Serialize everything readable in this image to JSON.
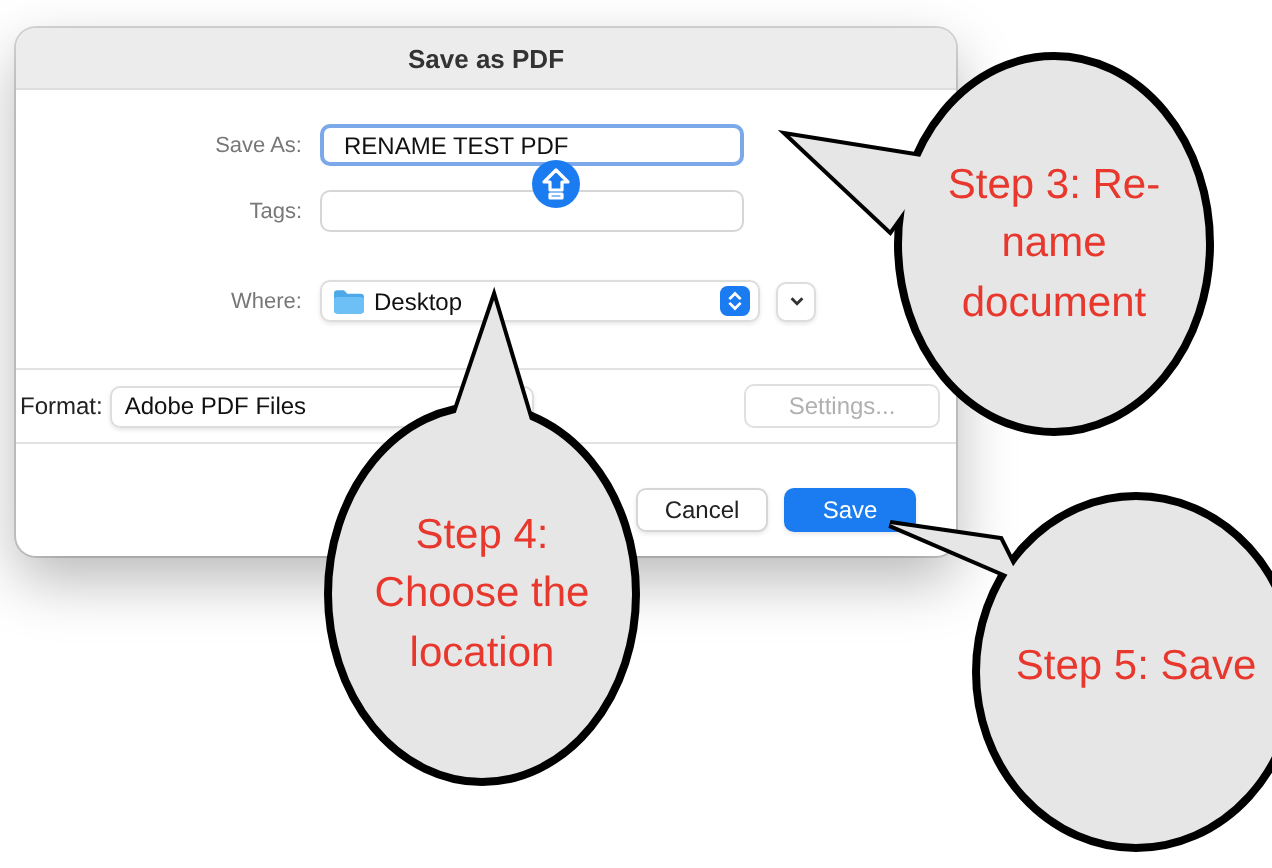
{
  "dialog": {
    "title": "Save as PDF",
    "fields": [
      {
        "label": "Save As:",
        "value": "RENAME TEST PDF",
        "focused": true
      },
      {
        "label": "Tags:",
        "focused": false
      }
    ],
    "where": {
      "label": "Where:",
      "value": "Desktop"
    },
    "format": {
      "label": "Format:",
      "value": "Adobe PDF Files"
    },
    "settings_button": {
      "label": "Settings...",
      "disabled": true
    },
    "buttons": [
      {
        "label": "Cancel",
        "default": false
      },
      {
        "label": "Save",
        "default": true
      }
    ]
  },
  "callouts": [
    {
      "lines": [
        "Step 3: Re-",
        "name",
        "document"
      ]
    },
    {
      "lines": [
        "Step 4:",
        "Choose the",
        "location"
      ]
    },
    {
      "lines": [
        "Step 5: Save"
      ]
    }
  ]
}
